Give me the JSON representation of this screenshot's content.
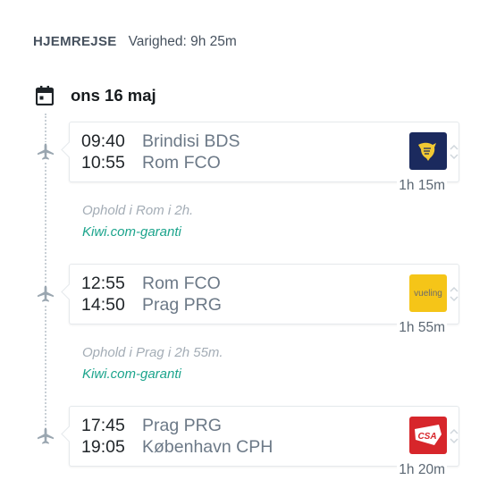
{
  "header": {
    "title": "HJEMREJSE",
    "duration": "Varighed: 9h 25m"
  },
  "date": {
    "label": "ons 16 maj",
    "icon": "calendar-icon"
  },
  "segments": [
    {
      "dep_time": "09:40",
      "dep_place": "Brindisi BDS",
      "arr_time": "10:55",
      "arr_place": "Rom FCO",
      "duration": "1h 15m",
      "airline": "Ryanair",
      "logo_color": "#1b2a5e"
    },
    {
      "dep_time": "12:55",
      "dep_place": "Rom FCO",
      "arr_time": "14:50",
      "arr_place": "Prag PRG",
      "duration": "1h 55m",
      "airline": "Vueling",
      "logo_text": "vueling",
      "logo_color": "#f5c518"
    },
    {
      "dep_time": "17:45",
      "dep_place": "Prag PRG",
      "arr_time": "19:05",
      "arr_place": "København CPH",
      "duration": "1h 20m",
      "airline": "Czech Airlines",
      "logo_text": "CSA",
      "logo_color": "#d7262b"
    }
  ],
  "layovers": [
    {
      "text": "Ophold i Rom i 2h.",
      "guarantee": "Kiwi.com-garanti"
    },
    {
      "text": "Ophold i Prag i 2h 55m.",
      "guarantee": "Kiwi.com-garanti"
    }
  ],
  "colors": {
    "accent_green": "#1ba48c",
    "muted_text": "#a4adb6"
  }
}
